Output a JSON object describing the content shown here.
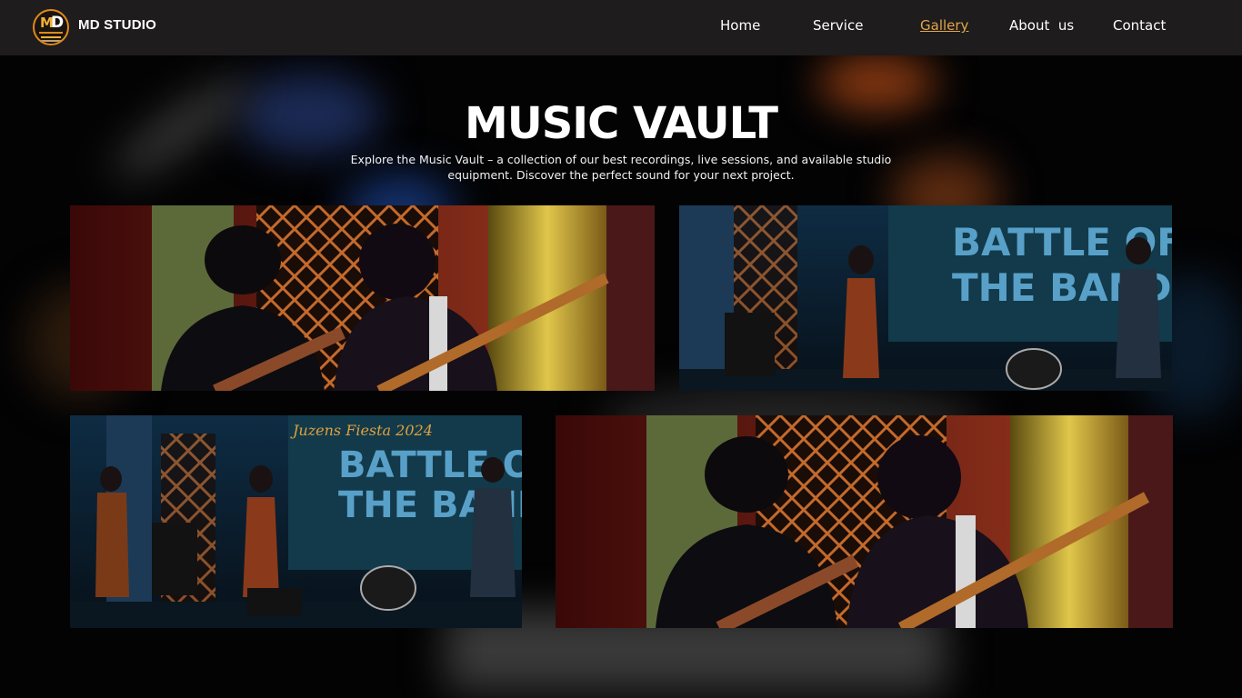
{
  "header": {
    "logo_icon": "md-production-logo",
    "brand": "MD STUDIO",
    "nav": [
      {
        "label": "Home",
        "active": false
      },
      {
        "label": "Service",
        "active": false
      },
      {
        "label": "Gallery",
        "active": true
      },
      {
        "label": "About  us",
        "active": false
      },
      {
        "label": "Contact",
        "active": false
      }
    ],
    "active_color": "#e2a54a"
  },
  "hero": {
    "title": "MUSIC VAULT",
    "description_line1": "Explore the Music Vault – a collection of our best recordings, live sessions, and available studio",
    "description_line2": "equipment. Discover the perfect sound for your next project."
  },
  "gallery": {
    "photos": [
      {
        "name": "guitarists-closeup-photo"
      },
      {
        "name": "band-stage-photo"
      },
      {
        "name": "band-stage-photo"
      },
      {
        "name": "guitarists-closeup-photo"
      }
    ],
    "stage_banner_line1": "BATTLE OF",
    "stage_banner_line2": "THE BAND",
    "stage_banner_script": "Juzens Fiesta 2024"
  },
  "colors": {
    "header_bg": "#1e1c1d",
    "page_bg": "#000000",
    "accent": "#e2a54a"
  }
}
